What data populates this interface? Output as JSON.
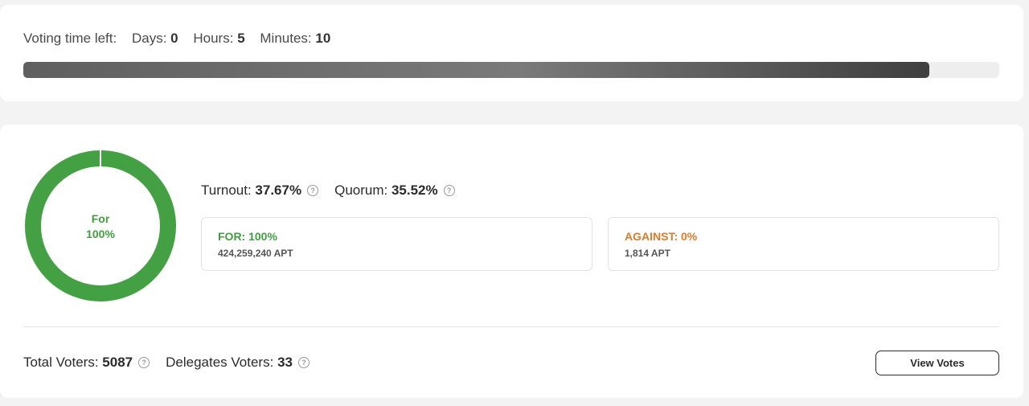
{
  "timer": {
    "label": "Voting time left:",
    "days_label": "Days:",
    "days": "0",
    "hours_label": "Hours:",
    "hours": "5",
    "minutes_label": "Minutes:",
    "minutes": "10",
    "progress_fraction": 0.928
  },
  "donut": {
    "label_line1": "For",
    "label_line2": "100%",
    "for_fraction": 0.997,
    "for_color": "#43a143",
    "gap_color": "#ffffff"
  },
  "stats": {
    "turnout_label": "Turnout:",
    "turnout_value": "37.67%",
    "quorum_label": "Quorum:",
    "quorum_value": "35.52%"
  },
  "votes": {
    "for_title": "FOR: 100%",
    "for_amount": "424,259,240 APT",
    "against_title": "AGAINST: 0%",
    "against_amount": "1,814 APT"
  },
  "voters": {
    "total_label": "Total Voters:",
    "total_value": "5087",
    "delegates_label": "Delegates Voters:",
    "delegates_value": "33"
  },
  "actions": {
    "view_votes_label": "View Votes"
  },
  "icons": {
    "help": "?"
  },
  "colors": {
    "for_green": "#3f9e3f",
    "against_orange": "#e07a2a"
  }
}
